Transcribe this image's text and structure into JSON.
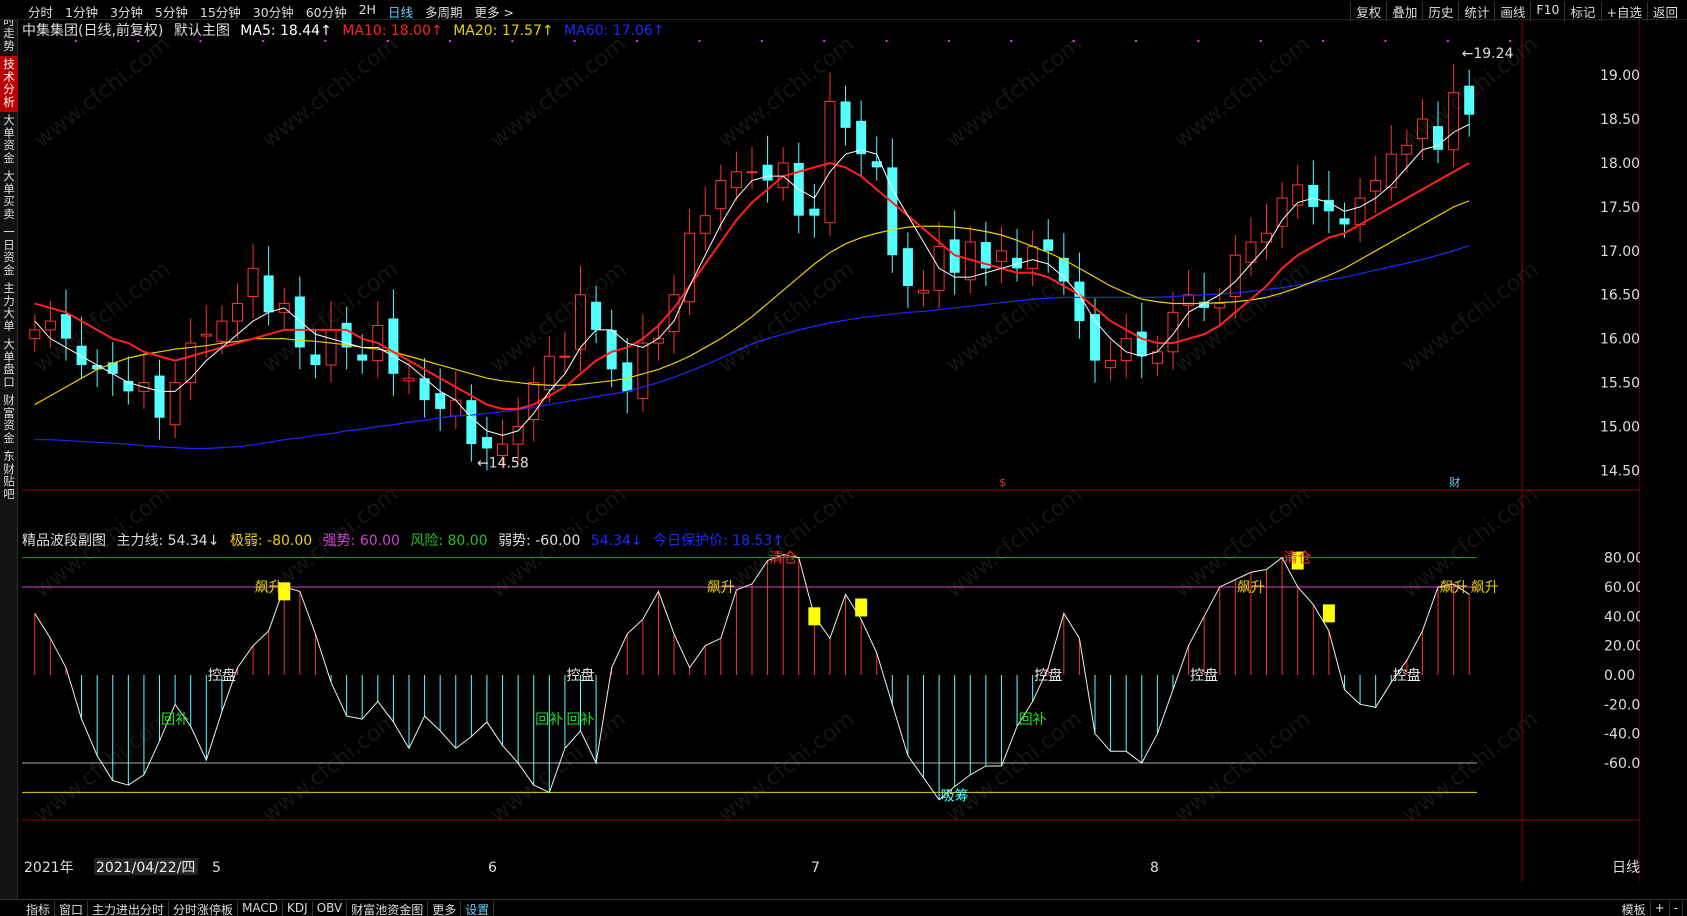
{
  "topbar": {
    "left_items": [
      "分时",
      "1分钟",
      "3分钟",
      "5分钟",
      "15分钟",
      "30分钟",
      "60分钟",
      "2H",
      "日线",
      "多周期",
      "更多 >"
    ],
    "active": "日线",
    "right_items": [
      "复权",
      "叠加",
      "历史",
      "统计",
      "画线",
      "F10",
      "标记",
      "+自选",
      "返回"
    ]
  },
  "sidebar": {
    "tabs": [
      "分时走势",
      "技术分析",
      "大单资金",
      "大单买卖",
      "一日资金",
      "主力大单",
      "大单盘口",
      "财富资金",
      "东财贴吧"
    ],
    "active": "技术分析"
  },
  "main_legend": {
    "title": "中集集团(日线,前复权)",
    "indicator": "默认主图",
    "ma5": "MA5: 18.44↑",
    "ma10": "MA10: 18.00↑",
    "ma20": "MA20: 17.57↑",
    "ma60": "MA60: 17.06↑",
    "colors": {
      "ma5": "#ffffff",
      "ma10": "#ff2020",
      "ma20": "#e8d000",
      "ma60": "#1a2aff"
    }
  },
  "sub_legend": {
    "name": "精品波段副图",
    "main_line": "主力线: 54.34↓",
    "weak_extreme": "极弱: -80.00",
    "strong": "强势: 60.00",
    "risk": "风险: 80.00",
    "weak": "弱势: -60.00",
    "extra": "54.34↓",
    "protect": "今日保护价: 18.53↑"
  },
  "main_axis": [
    "19.00",
    "18.50",
    "18.00",
    "17.50",
    "17.00",
    "16.50",
    "16.00",
    "15.50",
    "15.00",
    "14.50"
  ],
  "sub_axis": [
    "80.00",
    "60.00",
    "40.00",
    "20.00",
    "0.00",
    "-20.00",
    "-40.00",
    "-60.00"
  ],
  "annotations": {
    "high": "19.24",
    "low": "14.58",
    "fin1": "$",
    "fin2": "财"
  },
  "sub_labels": {
    "control": "控盘",
    "rise": "飙升",
    "refill": "回补",
    "clear": "清仓",
    "absorb": "吸筹"
  },
  "date_axis": {
    "year": "2021年",
    "cursor_date": "2021/04/22/四",
    "months": [
      "5",
      "6",
      "7",
      "8"
    ],
    "period": "日线"
  },
  "bottombar": {
    "items": [
      "指标",
      "窗口",
      "主力进出分时",
      "分时涨停板",
      "MACD",
      "KDJ",
      "OBV",
      "财富池资金图",
      "更多",
      "设置"
    ],
    "right_items": [
      "模板",
      "+",
      "-"
    ]
  },
  "watermark": "www.cfchi.com",
  "chart_data": {
    "type": "candlestick",
    "price_range": [
      14.3,
      19.4
    ],
    "closes": [
      16.1,
      16.2,
      16.0,
      15.7,
      15.65,
      15.6,
      15.4,
      15.5,
      15.1,
      15.5,
      15.95,
      16.05,
      16.2,
      16.4,
      16.8,
      16.3,
      16.4,
      15.9,
      15.7,
      16.1,
      15.9,
      15.75,
      16.15,
      15.6,
      15.55,
      15.3,
      15.2,
      15.3,
      14.8,
      14.75,
      14.8,
      15.0,
      15.5,
      15.8,
      15.8,
      16.5,
      16.1,
      15.65,
      15.4,
      15.95,
      16.0,
      16.5,
      17.2,
      17.4,
      17.8,
      17.9,
      17.9,
      17.8,
      18.0,
      17.4,
      17.4,
      18.7,
      18.4,
      18.1,
      17.95,
      16.95,
      16.6,
      16.55,
      17.05,
      16.75,
      17.1,
      16.8,
      17.0,
      16.8,
      17.05,
      17.0,
      16.65,
      16.2,
      15.75,
      15.75,
      16.0,
      15.8,
      15.85,
      16.3,
      16.5,
      16.35,
      16.4,
      16.95,
      17.1,
      17.2,
      17.6,
      17.75,
      17.5,
      17.45,
      17.3,
      17.6,
      17.8,
      18.1,
      18.2,
      18.5,
      18.15,
      18.8,
      18.55
    ],
    "ma5": [
      16.2,
      16.0,
      15.9,
      15.8,
      15.7,
      15.6,
      15.5,
      15.45,
      15.4,
      15.4,
      15.55,
      15.75,
      15.9,
      16.05,
      16.2,
      16.3,
      16.35,
      16.2,
      16.05,
      16.0,
      15.95,
      15.9,
      15.9,
      15.8,
      15.7,
      15.55,
      15.4,
      15.3,
      15.1,
      14.95,
      14.9,
      14.95,
      15.15,
      15.4,
      15.6,
      15.9,
      16.1,
      16.1,
      15.95,
      15.9,
      16.0,
      16.2,
      16.6,
      16.95,
      17.3,
      17.6,
      17.8,
      17.85,
      17.85,
      17.7,
      17.6,
      17.9,
      18.1,
      18.15,
      18.1,
      17.7,
      17.4,
      17.1,
      16.8,
      16.7,
      16.7,
      16.75,
      16.8,
      16.85,
      16.9,
      16.85,
      16.7,
      16.5,
      16.2,
      16.0,
      15.85,
      15.8,
      15.85,
      16.05,
      16.3,
      16.4,
      16.5,
      16.65,
      16.85,
      17.05,
      17.35,
      17.55,
      17.6,
      17.55,
      17.45,
      17.5,
      17.6,
      17.75,
      17.95,
      18.15,
      18.2,
      18.35,
      18.44
    ],
    "ma10": [
      16.4,
      16.35,
      16.3,
      16.2,
      16.1,
      16.0,
      15.95,
      15.85,
      15.8,
      15.75,
      15.8,
      15.85,
      15.9,
      15.95,
      16.0,
      16.05,
      16.1,
      16.1,
      16.1,
      16.1,
      16.1,
      16.0,
      15.95,
      15.85,
      15.75,
      15.65,
      15.55,
      15.45,
      15.35,
      15.25,
      15.2,
      15.2,
      15.25,
      15.35,
      15.45,
      15.6,
      15.75,
      15.85,
      15.9,
      16.0,
      16.15,
      16.35,
      16.6,
      16.85,
      17.1,
      17.35,
      17.55,
      17.7,
      17.85,
      17.9,
      17.95,
      18.0,
      17.95,
      17.85,
      17.7,
      17.55,
      17.4,
      17.25,
      17.1,
      16.95,
      16.9,
      16.85,
      16.8,
      16.75,
      16.75,
      16.7,
      16.6,
      16.5,
      16.35,
      16.2,
      16.1,
      16.0,
      15.95,
      15.95,
      16.0,
      16.05,
      16.15,
      16.3,
      16.45,
      16.6,
      16.8,
      16.95,
      17.05,
      17.15,
      17.2,
      17.3,
      17.4,
      17.5,
      17.6,
      17.7,
      17.8,
      17.9,
      18.0
    ],
    "ma20": [
      15.25,
      15.35,
      15.45,
      15.55,
      15.65,
      15.72,
      15.78,
      15.82,
      15.85,
      15.88,
      15.9,
      15.92,
      15.95,
      15.97,
      16.0,
      16.0,
      16.0,
      15.98,
      15.97,
      15.95,
      15.93,
      15.9,
      15.88,
      15.85,
      15.8,
      15.75,
      15.7,
      15.65,
      15.6,
      15.55,
      15.52,
      15.5,
      15.48,
      15.47,
      15.47,
      15.48,
      15.5,
      15.52,
      15.55,
      15.6,
      15.65,
      15.72,
      15.8,
      15.9,
      16.0,
      16.12,
      16.25,
      16.4,
      16.55,
      16.7,
      16.85,
      16.98,
      17.08,
      17.15,
      17.2,
      17.24,
      17.27,
      17.28,
      17.28,
      17.27,
      17.25,
      17.22,
      17.18,
      17.12,
      17.05,
      16.98,
      16.9,
      16.8,
      16.7,
      16.6,
      16.52,
      16.45,
      16.42,
      16.4,
      16.4,
      16.4,
      16.41,
      16.42,
      16.44,
      16.47,
      16.52,
      16.58,
      16.65,
      16.72,
      16.8,
      16.9,
      17.0,
      17.1,
      17.2,
      17.3,
      17.4,
      17.5,
      17.57
    ],
    "ma60": [
      14.85,
      14.85,
      14.84,
      14.83,
      14.82,
      14.81,
      14.8,
      14.78,
      14.77,
      14.76,
      14.75,
      14.75,
      14.76,
      14.77,
      14.79,
      14.82,
      14.85,
      14.87,
      14.9,
      14.92,
      14.95,
      14.97,
      15.0,
      15.02,
      15.05,
      15.07,
      15.1,
      15.12,
      15.13,
      15.15,
      15.17,
      15.19,
      15.22,
      15.25,
      15.28,
      15.31,
      15.34,
      15.37,
      15.4,
      15.45,
      15.5,
      15.56,
      15.63,
      15.7,
      15.78,
      15.86,
      15.94,
      16.0,
      16.05,
      16.1,
      16.14,
      16.18,
      16.21,
      16.24,
      16.26,
      16.28,
      16.3,
      16.31,
      16.33,
      16.35,
      16.37,
      16.39,
      16.41,
      16.43,
      16.45,
      16.46,
      16.47,
      16.47,
      16.47,
      16.47,
      16.47,
      16.47,
      16.47,
      16.48,
      16.49,
      16.5,
      16.51,
      16.52,
      16.54,
      16.56,
      16.58,
      16.61,
      16.64,
      16.67,
      16.7,
      16.74,
      16.78,
      16.82,
      16.86,
      16.9,
      16.95,
      17.0,
      17.06
    ],
    "sub_range": [
      -92,
      92
    ],
    "sub_series": [
      42,
      25,
      5,
      -30,
      -55,
      -72,
      -75,
      -68,
      -45,
      -20,
      -35,
      -58,
      -25,
      5,
      20,
      30,
      60,
      57,
      28,
      -5,
      -28,
      -30,
      -18,
      -32,
      -50,
      -28,
      -38,
      -50,
      -42,
      -32,
      -48,
      -60,
      -75,
      -80,
      -50,
      -38,
      -60,
      5,
      28,
      38,
      57,
      28,
      5,
      20,
      25,
      58,
      62,
      78,
      82,
      80,
      40,
      25,
      55,
      38,
      15,
      -20,
      -55,
      -70,
      -85,
      -76,
      -68,
      -62,
      -62,
      -35,
      -18,
      5,
      42,
      25,
      -40,
      -52,
      -52,
      -60,
      -40,
      -10,
      20,
      40,
      60,
      65,
      70,
      72,
      80,
      60,
      48,
      30,
      -10,
      -20,
      -22,
      -5,
      10,
      30,
      60,
      62,
      55
    ]
  }
}
